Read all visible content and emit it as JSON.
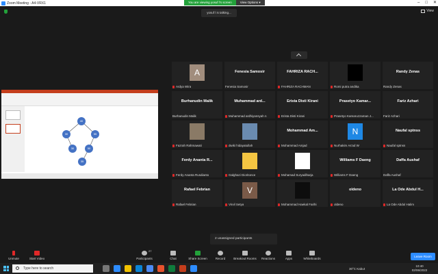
{
  "window": {
    "title": "Zoom Meeting - A4-VRX1",
    "controls": [
      "–",
      "□",
      "✕"
    ]
  },
  "share_banner": {
    "viewing": "You are viewing yosuf l's screen",
    "view_options": "View Options ▾"
  },
  "view_button": "View",
  "talking": "yosuf l is talking...",
  "shared_screen": {
    "nodes": [
      "40",
      "30",
      "55",
      "30",
      "50",
      "35"
    ]
  },
  "participants": [
    {
      "big": "",
      "name": "Ardya Wira",
      "photo": "letter-A",
      "letter": "A",
      "muted": true
    },
    {
      "big": "Fenesia Samosir",
      "name": "Fenesia Samosir",
      "muted": false
    },
    {
      "big": "FAHRIZA RACH...",
      "name": "FAHRIZA RACHMAN",
      "muted": true
    },
    {
      "big": "",
      "name": "Romi putra andika",
      "photo": "24-logo",
      "muted": true
    },
    {
      "big": "Randy Zenas",
      "name": "Randy Zenas",
      "muted": false
    },
    {
      "big": "Burhanudin Malik",
      "name": "Burhanudin Malik",
      "muted": false
    },
    {
      "big": "Muhammad ard...",
      "name": "Muhammad ardhiyansyah n",
      "muted": true
    },
    {
      "big": "Erista Disti Kirani",
      "name": "Erista Disti Kirani",
      "muted": true
    },
    {
      "big": "Prasetyo Kamar...",
      "name": "Prasetyo Kamaruzzaman J...",
      "muted": true
    },
    {
      "big": "Fariz Azhari",
      "name": "Fariz Azhari",
      "muted": false
    },
    {
      "big": "",
      "name": "Fazrah Rahmawati",
      "photo": "dog",
      "muted": true
    },
    {
      "big": "",
      "name": "dwiki hidayatullah",
      "photo": "group",
      "muted": true
    },
    {
      "big": "Mohammad Am...",
      "name": "Mohammad Amjad",
      "muted": true
    },
    {
      "big": "",
      "name": "Nurhakim As'ad W",
      "photo": "letter-N",
      "letter": "N",
      "muted": true
    },
    {
      "big": "Naufal sptnss",
      "name": "Naufal sptnss",
      "muted": true
    },
    {
      "big": "Ferdy Ananta R...",
      "name": "Ferdy Ananta Rusdianto",
      "muted": true
    },
    {
      "big": "",
      "name": "Galghazi Dioritonce",
      "photo": "emoji",
      "muted": true
    },
    {
      "big": "",
      "name": "Mohamad Suryadiharja",
      "photo": "default-avatar",
      "muted": true
    },
    {
      "big": "Williams F Daeng",
      "name": "Williams F Daeng",
      "muted": true
    },
    {
      "big": "Daffa Aushaf",
      "name": "Daffa Aushaf",
      "muted": false
    },
    {
      "big": "Rafael Febrian",
      "name": "Rafael Febrian",
      "muted": true
    },
    {
      "big": "",
      "name": "Virvil Setya",
      "photo": "letter-V",
      "letter": "V",
      "muted": true
    },
    {
      "big": "",
      "name": "Mohammad Haekal Farihi",
      "photo": "dark-figure",
      "muted": true
    },
    {
      "big": "oldeno",
      "name": "oldeno",
      "muted": true
    },
    {
      "big": "La Ode Abdul H...",
      "name": "La Ode Abdul Halim",
      "muted": true
    }
  ],
  "unassigned": "2 unassigned participants",
  "toolbar": {
    "unmute": "Unmute",
    "start_video": "Start Video",
    "participants": "Participants",
    "participants_count": "27",
    "chat": "Chat",
    "share_screen": "Share Screen",
    "record": "Record",
    "breakout": "Breakout Rooms",
    "reactions": "Reactions",
    "apps": "Apps",
    "whiteboards": "Whiteboards",
    "leave": "Leave Room"
  },
  "taskbar": {
    "search_placeholder": "Type here to search",
    "weather": "30°C  Kabut",
    "time": "10:40",
    "date": "02/06/2022"
  },
  "colors": {
    "accent": "#2d8cff",
    "green": "#23a13a",
    "muted_red": "#e02828"
  }
}
